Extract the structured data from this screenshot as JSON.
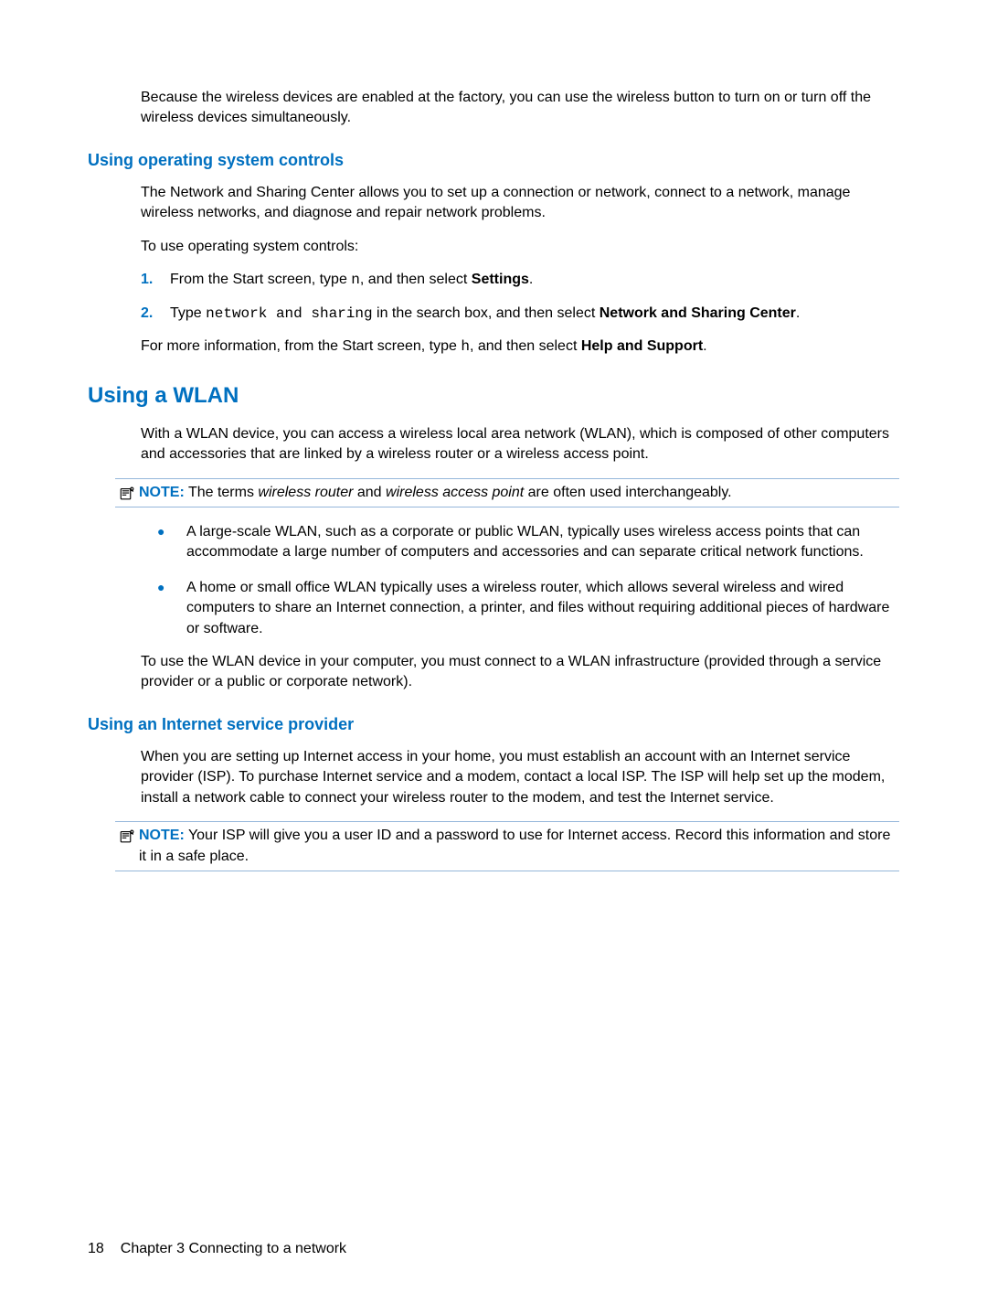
{
  "intro": "Because the wireless devices are enabled at the factory, you can use the wireless button to turn on or turn off the wireless devices simultaneously.",
  "sec1": {
    "heading": "Using operating system controls",
    "para1": "The Network and Sharing Center allows you to set up a connection or network, connect to a network, manage wireless networks, and diagnose and repair network problems.",
    "para2": "To use operating system controls:",
    "step1": {
      "num": "1.",
      "pre": "From the Start screen, type ",
      "code": "n",
      "mid": ", and then select ",
      "bold": "Settings",
      "post": "."
    },
    "step2": {
      "num": "2.",
      "pre": "Type ",
      "code": "network and sharing",
      "mid": " in the search box, and then select ",
      "bold": "Network and Sharing Center",
      "post": "."
    },
    "para3": {
      "pre": "For more information, from the Start screen, type ",
      "code": "h",
      "mid": ", and then select ",
      "bold": "Help and Support",
      "post": "."
    }
  },
  "sec2": {
    "heading": "Using a WLAN",
    "para1": "With a WLAN device, you can access a wireless local area network (WLAN), which is composed of other computers and accessories that are linked by a wireless router or a wireless access point.",
    "note": {
      "label": "NOTE:",
      "pre": "   The terms ",
      "i1": "wireless router",
      "mid": " and ",
      "i2": "wireless access point",
      "post": " are often used interchangeably."
    },
    "bullet1": "A large-scale WLAN, such as a corporate or public WLAN, typically uses wireless access points that can accommodate a large number of computers and accessories and can separate critical network functions.",
    "bullet2": "A home or small office WLAN typically uses a wireless router, which allows several wireless and wired computers to share an Internet connection, a printer, and files without requiring additional pieces of hardware or software.",
    "para2": "To use the WLAN device in your computer, you must connect to a WLAN infrastructure (provided through a service provider or a public or corporate network)."
  },
  "sec3": {
    "heading": "Using an Internet service provider",
    "para1": "When you are setting up Internet access in your home, you must establish an account with an Internet service provider (ISP). To purchase Internet service and a modem, contact a local ISP. The ISP will help set up the modem, install a network cable to connect your wireless router to the modem, and test the Internet service.",
    "note": {
      "label": "NOTE:",
      "text": "   Your ISP will give you a user ID and a password to use for Internet access. Record this information and store it in a safe place."
    }
  },
  "footer": {
    "pagenum": "18",
    "chapter": "Chapter 3   Connecting to a network"
  }
}
